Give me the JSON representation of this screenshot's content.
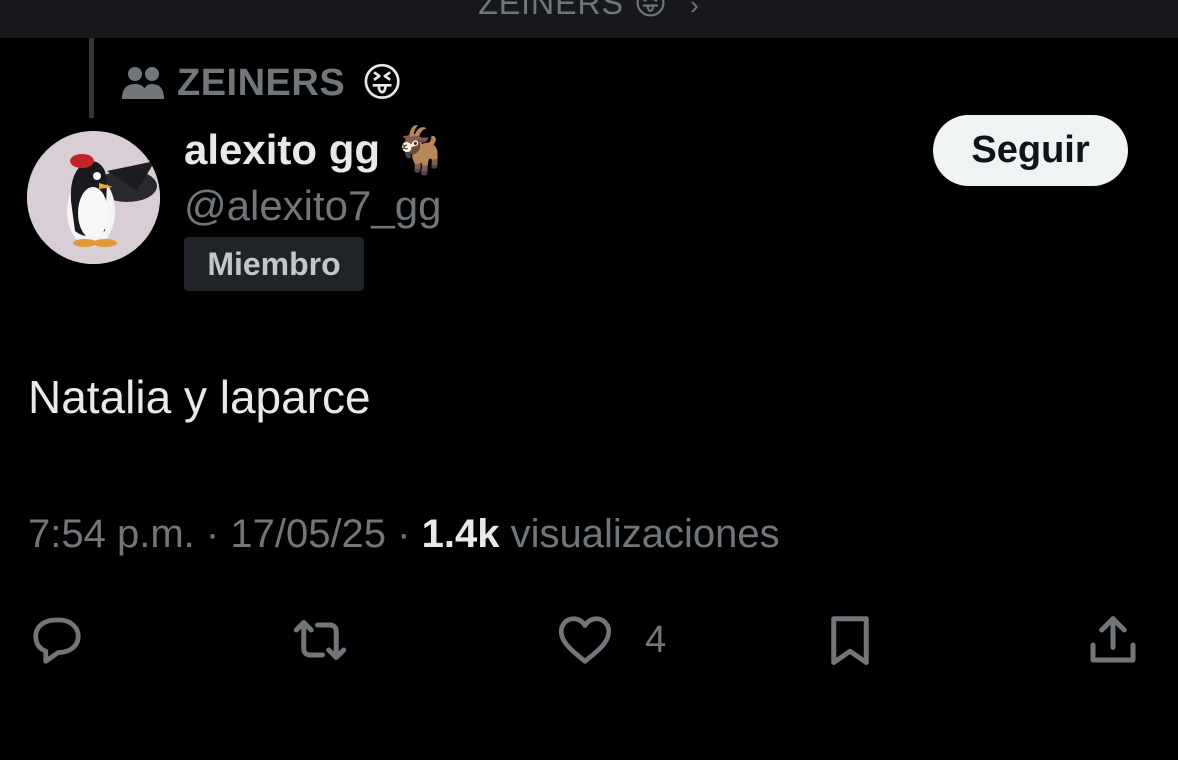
{
  "top_bar": {
    "community_name": "ZEINERS",
    "emoji": "😝",
    "chevron": "›"
  },
  "community": {
    "icon": "people-icon",
    "name": "ZEINERS",
    "emoji": "😝"
  },
  "author": {
    "display_name": "alexito gg",
    "name_emoji": "🐐",
    "handle": "@alexito7_gg",
    "badge": "Miembro",
    "avatar_icon": "penguin-cartoon-avatar"
  },
  "follow_button": {
    "label": "Seguir"
  },
  "tweet": {
    "text": "Natalia y laparce",
    "time": "7:54 p.m.",
    "separator": "·",
    "date": "17/05/25",
    "views_count": "1.4k",
    "views_label": "visualizaciones"
  },
  "actions": {
    "reply_icon": "reply-icon",
    "retweet_icon": "retweet-icon",
    "like_icon": "heart-icon",
    "like_count": "4",
    "bookmark_icon": "bookmark-icon",
    "share_icon": "share-icon"
  },
  "colors": {
    "background": "#000000",
    "primary_text": "#e7e9ea",
    "secondary_text": "#71767b",
    "button_bg": "#eff3f4",
    "badge_bg": "#202327"
  }
}
